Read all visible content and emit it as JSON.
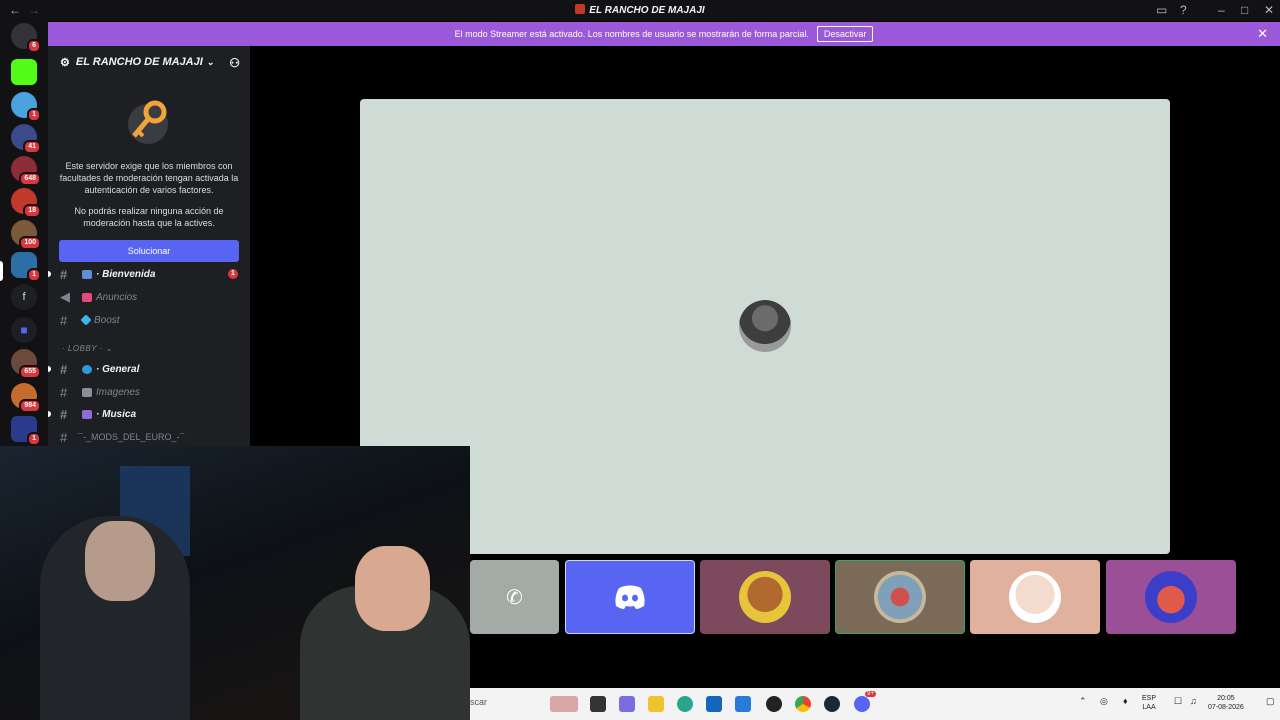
{
  "window": {
    "title": "EL RANCHO DE MAJAJI",
    "back_glyph": "←",
    "forward_glyph": "→"
  },
  "banner": {
    "message": "El modo Streamer está activado. Los nombres de usuario se mostrarán de forma parcial.",
    "button_label": "Desactivar",
    "close_glyph": "✕",
    "color": "#9b59d9"
  },
  "guilds": {
    "badges": [
      "6",
      "1",
      "41",
      "648",
      "18",
      "100",
      "1",
      "655",
      "984",
      "1"
    ],
    "letter_server": "f"
  },
  "server": {
    "name": "EL RANCHO DE MAJAJI",
    "notice_1": "Este servidor exige que los miembros con facultades de moderación tengan activada la autenticación de varios factores.",
    "notice_2": "No podrás realizar ninguna acción de moderación hasta que la actives.",
    "solve_label": "Solucionar",
    "category": "· LOBBY ·",
    "channels": [
      {
        "name": "· Bienvenida",
        "badge": "1"
      },
      {
        "name": "Anuncios"
      },
      {
        "name": "Boost"
      },
      {
        "name": "· General"
      },
      {
        "name": "Imagenes"
      },
      {
        "name": "· Musica"
      },
      {
        "name": "¯-_MODS_DEL_EURO_-¯"
      }
    ]
  },
  "taskbar": {
    "search_text": "scar",
    "lang_1": "ESP",
    "lang_2": "LAA",
    "time": "20:05",
    "date": "07-08-2026",
    "discord_badge": "9+"
  },
  "colors": {
    "accent": "#5865f2",
    "stage_bg": "#cfdcd6",
    "badge": "#da373c"
  }
}
